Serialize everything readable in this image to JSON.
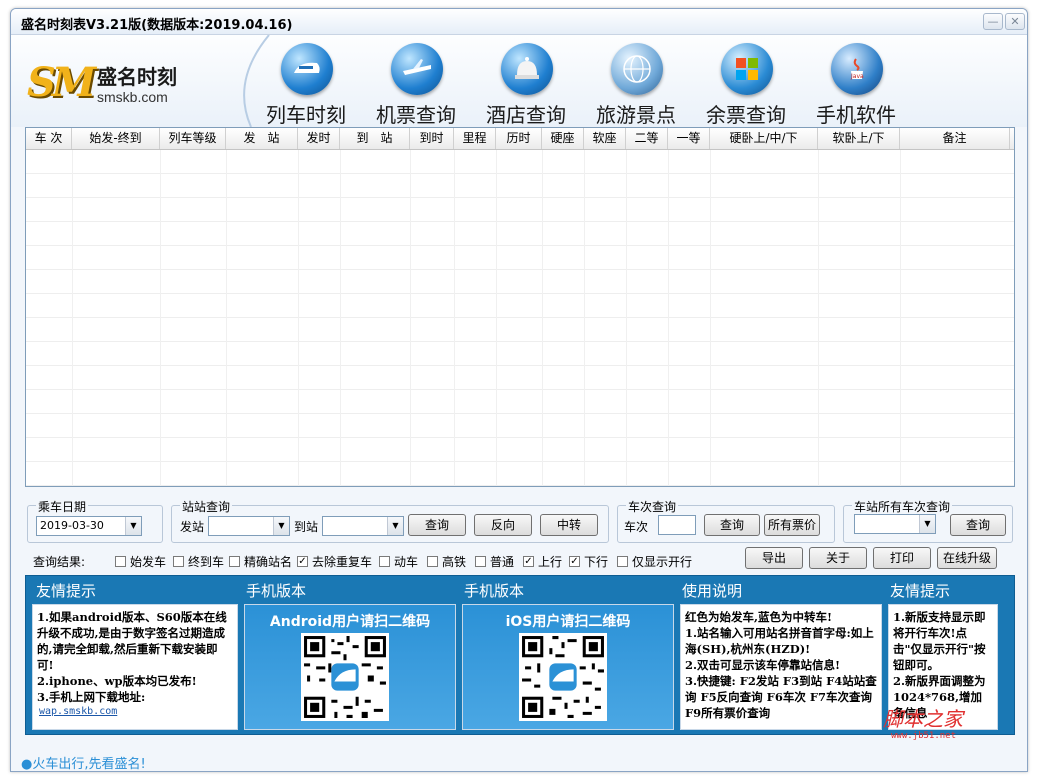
{
  "window": {
    "title": "盛名时刻表V3.21版(数据版本:2019.04.16)",
    "minimize": "—",
    "close": "✕"
  },
  "logo": {
    "mark": "SM",
    "cn": "盛名时刻",
    "en": "smskb.com"
  },
  "nav": [
    {
      "label": "列车时刻",
      "icon": "train-icon"
    },
    {
      "label": "机票查询",
      "icon": "airplane-icon"
    },
    {
      "label": "酒店查询",
      "icon": "hotel-bell-icon"
    },
    {
      "label": "旅游景点",
      "icon": "globe-icon"
    },
    {
      "label": "余票查询",
      "icon": "windows-icon"
    },
    {
      "label": "手机软件",
      "icon": "java-icon"
    }
  ],
  "table": {
    "columns": [
      "车 次",
      "始发-终到",
      "列车等级",
      "发　站",
      "发时",
      "到　站",
      "到时",
      "里程",
      "历时",
      "硬座",
      "软座",
      "二等",
      "一等",
      "硬卧上/中/下",
      "软卧上/下",
      "备注"
    ],
    "rows": []
  },
  "date_group": {
    "title": "乘车日期",
    "value": "2019-03-30"
  },
  "station_group": {
    "title": "站站查询",
    "from_label": "发站",
    "to_label": "到站",
    "from_value": "",
    "to_value": "",
    "query": "查询",
    "reverse": "反向",
    "transfer": "中转"
  },
  "train_group": {
    "title": "车次查询",
    "label": "车次",
    "value": "",
    "query": "查询",
    "all_tickets": "所有票价"
  },
  "allstation_group": {
    "title": "车站所有车次查询",
    "value": "",
    "query": "查询"
  },
  "filters": {
    "label": "查询结果:",
    "items": [
      {
        "label": "始发车",
        "checked": false
      },
      {
        "label": "终到车",
        "checked": false
      },
      {
        "label": "精确站名",
        "checked": false
      },
      {
        "label": "去除重复车",
        "checked": true
      },
      {
        "label": "动车",
        "checked": false
      },
      {
        "label": "高铁",
        "checked": false
      },
      {
        "label": "普通",
        "checked": false
      },
      {
        "label": "上行",
        "checked": true
      },
      {
        "label": "下行",
        "checked": true
      },
      {
        "label": "仅显示开行",
        "checked": false
      }
    ]
  },
  "actions": {
    "export": "导出",
    "about": "关于",
    "print": "打印",
    "upgrade": "在线升级"
  },
  "panels": {
    "tip1": {
      "title": "友情提示",
      "text": "1.如果android版本、S60版本在线升级不成功,是由于数字签名过期造成的,请完全卸载,然后重新下载安装即可!\n2.iphone、wp版本均已发布!\n3.手机上网下载地址:",
      "link": "wap.smskb.com"
    },
    "android": {
      "title": "手机版本",
      "caption": "Android用户请扫二维码"
    },
    "ios": {
      "title": "手机版本",
      "caption": "iOS用户请扫二维码"
    },
    "usage": {
      "title": "使用说明",
      "text": "红色为始发车,蓝色为中转车!\n1.站名输入可用站名拼音首字母:如上海(SH),杭州东(HZD)!\n2.双击可显示该车停靠站信息!\n3.快捷键: F2发站 F3到站 F4站站查询 F5反向查询 F6车次 F7车次查询 F9所有票价查询"
    },
    "tip2": {
      "title": "友情提示",
      "text": "1.新版支持显示即将开行车次!点击\"仅显示开行\"按钮即可。\n2.新版界面调整为1024*768,增加备信息"
    }
  },
  "footer": {
    "slogan": "●火车出行,先看盛名!"
  },
  "watermark": {
    "text": "脚本之家",
    "url": "www.jb51.net"
  }
}
